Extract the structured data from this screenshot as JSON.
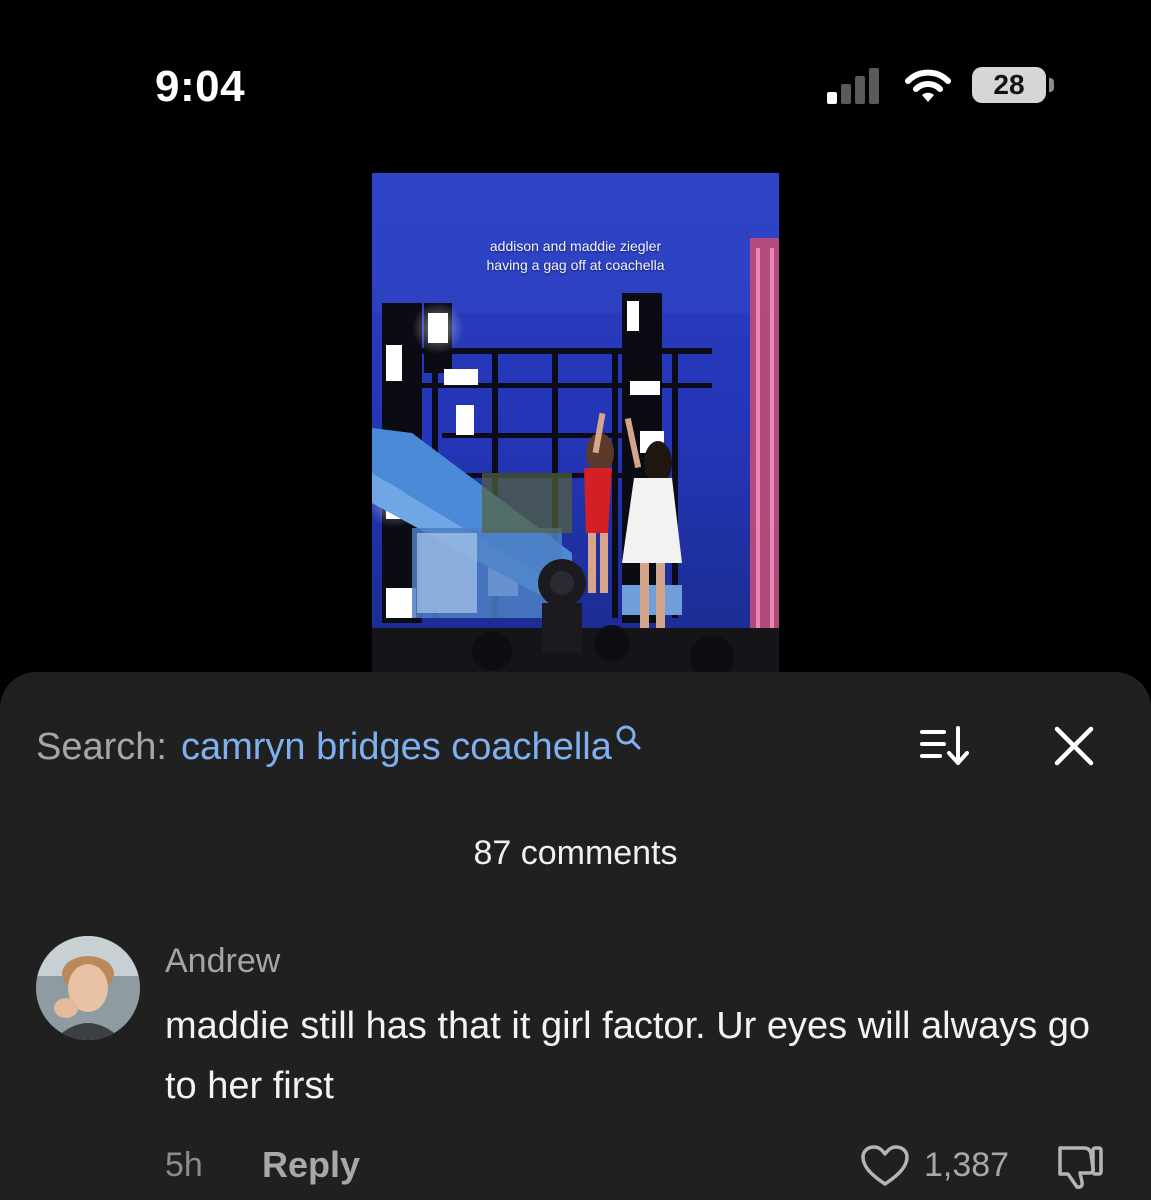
{
  "status_bar": {
    "time": "9:04",
    "battery": "28"
  },
  "video": {
    "caption_line1": "addison and maddie ziegler",
    "caption_line2": "having a gag off at coachella"
  },
  "sheet": {
    "search_prefix": "Search:",
    "search_query": "camryn bridges coachella",
    "comments_count": "87 comments"
  },
  "comment": {
    "username": "Andrew",
    "text": "maddie still has that it girl factor. Ur eyes will always go to her first",
    "time_ago": "5h",
    "reply_label": "Reply",
    "likes": "1,387"
  },
  "icons": [
    "search-icon",
    "sort-icon",
    "close-icon",
    "heart-icon",
    "dislike-icon",
    "signal-icon",
    "wifi-icon",
    "battery-icon"
  ],
  "colors": {
    "background": "#000000",
    "sheet": "#202020",
    "accent": "#7fb0f0"
  }
}
